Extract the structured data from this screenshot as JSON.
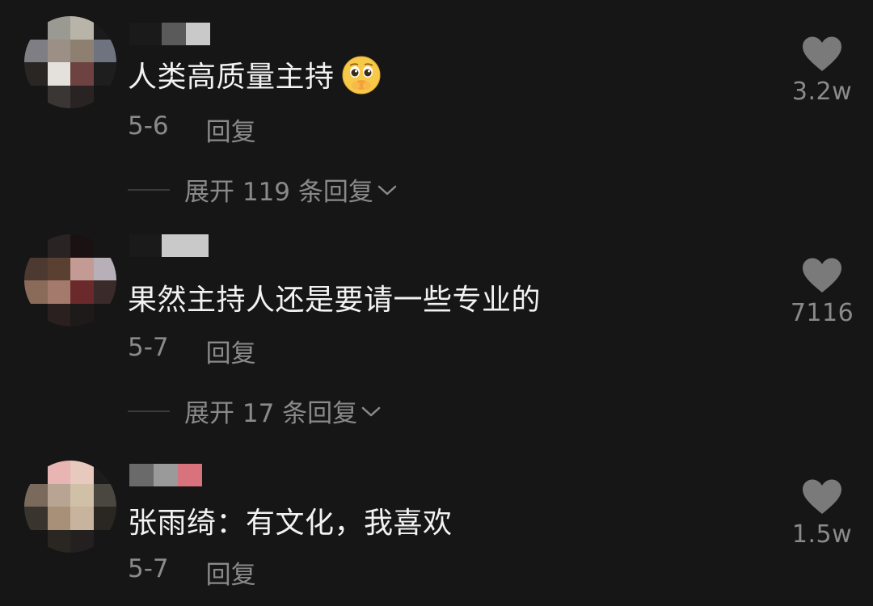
{
  "theme": {
    "background": "#161616",
    "text_primary": "#f2f2f2",
    "text_secondary": "#8a8a8a",
    "heart_color": "#7a7a7a"
  },
  "comments": [
    {
      "text": "人类高质量主持",
      "emoji": "pleading-face-emoji",
      "date": "5-6",
      "reply_label": "回复",
      "expand_label": "展开 119 条回复",
      "like_count": "3.2w",
      "like_icon": "heart-icon"
    },
    {
      "text": "果然主持人还是要请一些专业的",
      "date": "5-7",
      "reply_label": "回复",
      "expand_label": "展开 17 条回复",
      "like_count": "7116",
      "like_icon": "heart-icon"
    },
    {
      "text": "张雨绮：有文化，我喜欢",
      "date": "5-7",
      "reply_label": "回复",
      "like_count": "1.5w",
      "like_icon": "heart-icon"
    }
  ]
}
